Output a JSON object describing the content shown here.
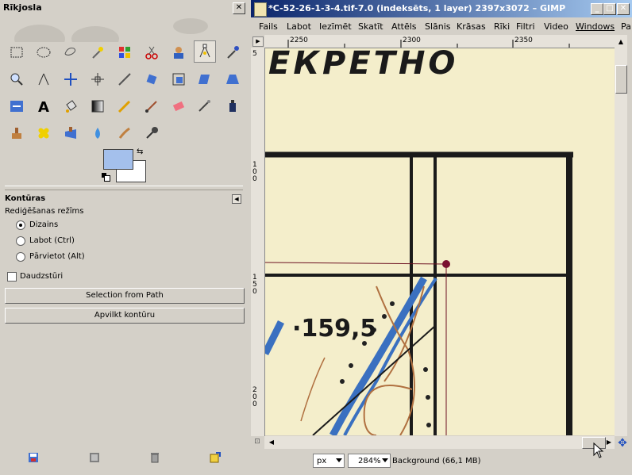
{
  "toolbox": {
    "title": "Rīkjosla",
    "tool_options_title": "Kontūras",
    "edit_mode_label": "Rediģēšanas režīms",
    "modes": [
      "Dizains",
      "Labot (Ctrl)",
      "Pārvietot (Alt)"
    ],
    "selected_mode": "Dizains",
    "polygonal_label": "Daudzstūri",
    "selection_button": "Selection from Path",
    "stroke_button": "Apvilkt kontūru",
    "fg_color": "#a4c0ec",
    "bg_color": "#ffffff"
  },
  "image_window": {
    "title": "*C-52-26-1-3-4.tif-7.0 (indeksēts, 1 layer) 2397x3072 – GIMP",
    "menus": [
      "Fails",
      "Labot",
      "Iezīmēt",
      "Skatīt",
      "Attēls",
      "Slānis",
      "Krāsas",
      "Rīki",
      "Filtri",
      "Video",
      "Windows",
      "Pa"
    ],
    "hruler_ticks": [
      "2250",
      "2300",
      "2350"
    ],
    "vruler_ticks": [
      "5",
      "1 0 0",
      "1 5 0",
      "2 0 0"
    ],
    "map_text_top": "ЕКРЕТНО",
    "map_elevation": "·159,5",
    "unit": "px",
    "zoom": "284%",
    "status_text": "Background (66,1 MB)"
  }
}
